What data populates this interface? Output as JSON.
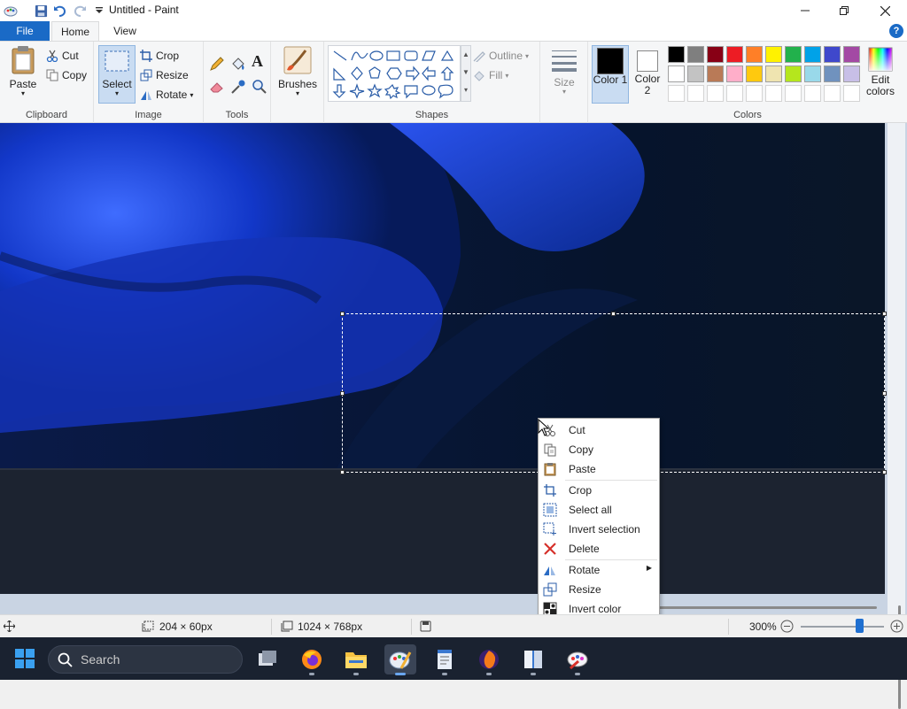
{
  "title_bar": {
    "title": "Untitled - Paint",
    "minimize_icon": "minimize-icon",
    "maximize_icon": "restore-icon",
    "close_icon": "close-icon"
  },
  "quick_access": [
    "paint-app-icon",
    "save-icon",
    "undo-icon",
    "redo-icon",
    "customize-dropdown-icon"
  ],
  "tabs": {
    "file": "File",
    "home": "Home",
    "view": "View",
    "help": "?"
  },
  "ribbon": {
    "clipboard": {
      "label": "Clipboard",
      "paste": "Paste",
      "cut": "Cut",
      "copy": "Copy"
    },
    "image": {
      "label": "Image",
      "select": "Select",
      "crop": "Crop",
      "resize": "Resize",
      "rotate": "Rotate"
    },
    "tools": {
      "label": "Tools"
    },
    "brushes": {
      "label": "Brushes"
    },
    "shapes": {
      "label": "Shapes",
      "outline": "Outline",
      "fill": "Fill"
    },
    "size": {
      "label": "Size"
    },
    "colors": {
      "label": "Colors",
      "color1": "Color 1",
      "color2": "Color 2",
      "edit": "Edit colors",
      "color1_value": "#000000",
      "color2_value": "#ffffff",
      "palette_row1": [
        "#000000",
        "#7f7f7f",
        "#880015",
        "#ed1c24",
        "#ff7f27",
        "#fff200",
        "#22b14c",
        "#00a2e8",
        "#3f48cc",
        "#a349a4"
      ],
      "palette_row2": [
        "#ffffff",
        "#c3c3c3",
        "#b97a57",
        "#ffaec9",
        "#ffc90e",
        "#efe4b0",
        "#b5e61d",
        "#99d9ea",
        "#7092be",
        "#c8bfe7"
      ],
      "palette_row3": [
        "#ffffff",
        "#ffffff",
        "#ffffff",
        "#ffffff",
        "#ffffff",
        "#ffffff",
        "#ffffff",
        "#ffffff",
        "#ffffff",
        "#ffffff"
      ]
    }
  },
  "context_menu": {
    "items": [
      {
        "label": "Cut",
        "icon": "scissors-icon"
      },
      {
        "label": "Copy",
        "icon": "copy-icon"
      },
      {
        "label": "Paste",
        "icon": "paste-icon"
      },
      {
        "label": "Crop",
        "icon": "crop-icon"
      },
      {
        "label": "Select all",
        "icon": "select-all-icon"
      },
      {
        "label": "Invert selection",
        "icon": "invert-selection-icon"
      },
      {
        "label": "Delete",
        "icon": "delete-icon"
      },
      {
        "label": "Rotate",
        "icon": "rotate-icon"
      },
      {
        "label": "Resize",
        "icon": "resize-icon"
      },
      {
        "label": "Invert color",
        "icon": "invert-color-icon"
      }
    ]
  },
  "status_bar": {
    "selection_size": "204 × 60px",
    "image_size": "1024 × 768px",
    "zoom": "300%",
    "zoom_level": 0.7
  },
  "taskbar": {
    "search_placeholder": "Search",
    "apps": [
      "start-icon",
      "task-view-icon",
      "firefox-icon",
      "file-explorer-icon",
      "paint-icon",
      "notepad-icon",
      "tor-browser-icon",
      "reader-icon",
      "paint-alt-icon"
    ]
  }
}
